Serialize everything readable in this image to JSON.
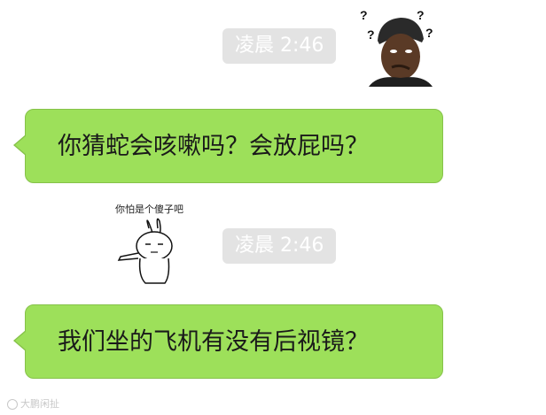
{
  "messages": [
    {
      "timestamp": "凌晨 2:46",
      "text": "你猜蛇会咳嗽吗？会放屁吗？"
    },
    {
      "timestamp": "凌晨 2:46",
      "text": "我们坐的飞机有没有后视镜？"
    }
  ],
  "avatar": {
    "icon": "confused-man-avatar-icon"
  },
  "sticker": {
    "caption": "你怕是个傻子吧",
    "icon": "rabbit-sticker-icon"
  },
  "watermark": {
    "text": "大鹏闲扯",
    "icon": "weibo-icon"
  },
  "colors": {
    "bubble": "#9de05a",
    "bubble_border": "#86c24a",
    "timestamp_bg": "#e3e3e3",
    "background": "#ffffff"
  }
}
